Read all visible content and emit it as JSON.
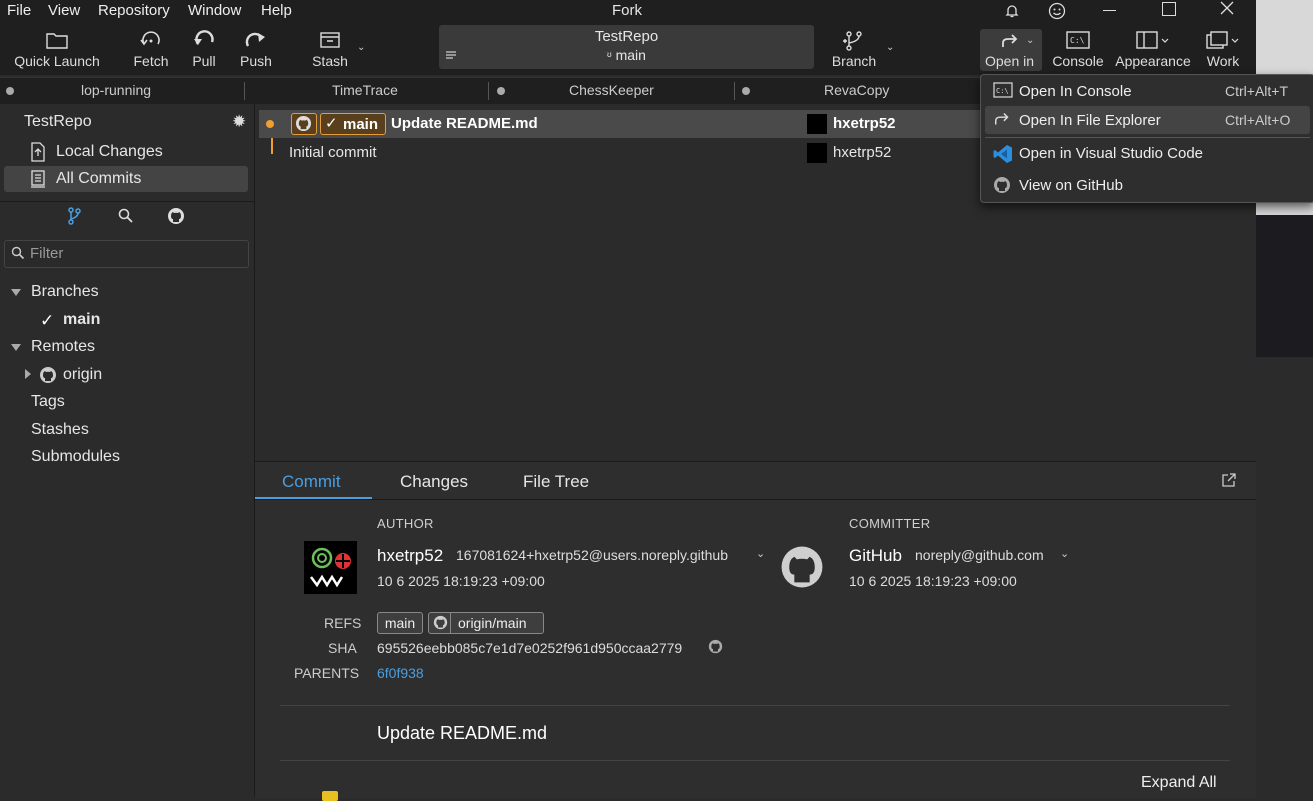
{
  "menubar": {
    "items": [
      "File",
      "View",
      "Repository",
      "Window",
      "Help"
    ],
    "app_title": "Fork"
  },
  "toolbar": {
    "quick_launch": "Quick Launch",
    "fetch": "Fetch",
    "pull": "Pull",
    "push": "Push",
    "stash": "Stash",
    "repo_name": "TestRepo",
    "repo_branch": "main",
    "branch": "Branch",
    "open_in": "Open in",
    "console": "Console",
    "appearance": "Appearance",
    "work": "Work"
  },
  "repo_tabs": [
    "lop-running",
    "TimeTrace",
    "ChessKeeper",
    "RevaCopy"
  ],
  "sidebar": {
    "repo_title": "TestRepo",
    "local_changes": "Local Changes",
    "all_commits": "All Commits",
    "filter_placeholder": "Filter",
    "branches": "Branches",
    "branch_main": "main",
    "remotes": "Remotes",
    "remote_origin": "origin",
    "tags": "Tags",
    "stashes": "Stashes",
    "submodules": "Submodules"
  },
  "commits": [
    {
      "badge": "main",
      "message": "Update README.md",
      "author": "hxetrp52"
    },
    {
      "message": "Initial commit",
      "author": "hxetrp52"
    }
  ],
  "detail": {
    "tabs": [
      "Commit",
      "Changes",
      "File Tree"
    ],
    "author_caption": "AUTHOR",
    "author_name": "hxetrp52",
    "author_email": "167081624+hxetrp52@users.noreply.github",
    "author_date": "10 6 2025 18:19:23 +09:00",
    "committer_caption": "COMMITTER",
    "committer_name": "GitHub",
    "committer_email": "noreply@github.com",
    "committer_date": "10 6 2025 18:19:23 +09:00",
    "refs_caption": "REFS",
    "refs": [
      "main",
      "origin/main"
    ],
    "sha_caption": "SHA",
    "sha": "695526eebb085c7e1d7e0252f961d950ccaa2779",
    "parents_caption": "PARENTS",
    "parents": "6f0f938",
    "message": "Update README.md",
    "expand_all": "Expand All"
  },
  "open_in_menu": [
    {
      "label": "Open In Console",
      "shortcut": "Ctrl+Alt+T",
      "icon": "console-icon"
    },
    {
      "label": "Open In File Explorer",
      "shortcut": "Ctrl+Alt+O",
      "icon": "share-arrow-icon"
    },
    {
      "label": "Open in Visual Studio Code",
      "shortcut": "",
      "icon": "vscode-icon"
    },
    {
      "label": "View on GitHub",
      "shortcut": "",
      "icon": "github-icon"
    }
  ],
  "colors": {
    "accent": "#4a9fe0",
    "branch_badge_border": "#e39e3b",
    "graph_line": "#f0a030",
    "vscode_blue": "#2b8fe0"
  }
}
